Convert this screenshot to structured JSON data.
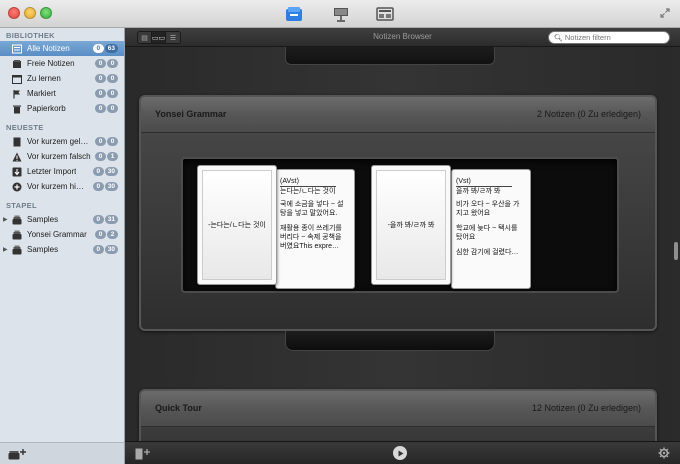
{
  "titlebar": {
    "mode_icons": [
      "library-icon",
      "study-icon",
      "edit-icon"
    ]
  },
  "sidebar": {
    "sections": {
      "library": "BIBLIOTHEK",
      "recent": "NEUESTE",
      "stacks": "STAPEL"
    },
    "library_items": [
      {
        "label": "Alle Notizen",
        "icon": "all-notes-icon",
        "badge1": "0",
        "badge2": "63",
        "selected": true
      },
      {
        "label": "Freie Notizen",
        "icon": "free-notes-icon",
        "badge1": "0",
        "badge2": "0"
      },
      {
        "label": "Zu lernen",
        "icon": "calendar-icon",
        "badge1": "0",
        "badge2": "0"
      },
      {
        "label": "Markiert",
        "icon": "flag-icon",
        "badge1": "0",
        "badge2": "0"
      },
      {
        "label": "Papierkorb",
        "icon": "trash-icon",
        "badge1": "0",
        "badge2": "0"
      }
    ],
    "recent_items": [
      {
        "label": "Vor kurzem gel…",
        "icon": "card-icon",
        "badge1": "0",
        "badge2": "0"
      },
      {
        "label": "Vor kurzem falsch",
        "icon": "warning-icon",
        "badge1": "0",
        "badge2": "1"
      },
      {
        "label": "Letzter Import",
        "icon": "import-icon",
        "badge1": "0",
        "badge2": "30"
      },
      {
        "label": "Vor kurzem hi…",
        "icon": "add-circle-icon",
        "badge1": "0",
        "badge2": "30"
      }
    ],
    "stack_items": [
      {
        "label": "Samples",
        "icon": "stack-icon",
        "badge1": "0",
        "badge2": "31",
        "expandable": true
      },
      {
        "label": "Yonsei Grammar",
        "icon": "stack-icon",
        "badge1": "0",
        "badge2": "2"
      },
      {
        "label": "Samples",
        "icon": "stack-icon",
        "badge1": "0",
        "badge2": "30",
        "expandable": true
      }
    ]
  },
  "toolbar": {
    "title": "Notizen Browser",
    "view_modes": [
      "▤",
      "▭▭",
      "☰"
    ],
    "filter_placeholder": "Notizen filtern"
  },
  "decks": [
    {
      "title": "Yonsei Grammar",
      "count": "2 Notizen (0 Zu erledigen)",
      "cards": [
        {
          "front": "-는다는/ㄴ다는 것이",
          "back_keyword": "(AVst)",
          "back_lines": [
            "는다는/ㄴ다는 것이",
            "국에 소금을 넣다 ~ 설",
            "탕을 넣고 말았어요.",
            "재활용 종이 쓰레기를",
            "버리다 ~ 속제 공책을",
            "버였요This expre…"
          ]
        },
        {
          "front": "-을까 봐/ㄹ까 봐",
          "back_keyword": "(Vst)",
          "back_lines": [
            "을까 봐/ㄹ까 봐",
            "비가 오다 ~ 우산을 가",
            "지고 왔어요",
            "학교에 늦다 ~ 택시를",
            "탔어요",
            "심한 감기에 걸렸다…"
          ]
        }
      ]
    },
    {
      "title": "Quick Tour",
      "count": "12 Notizen (0 Zu erledigen)"
    }
  ],
  "bottombar": {
    "icons": [
      "new-card-icon",
      "play-icon",
      "gear-icon"
    ]
  }
}
